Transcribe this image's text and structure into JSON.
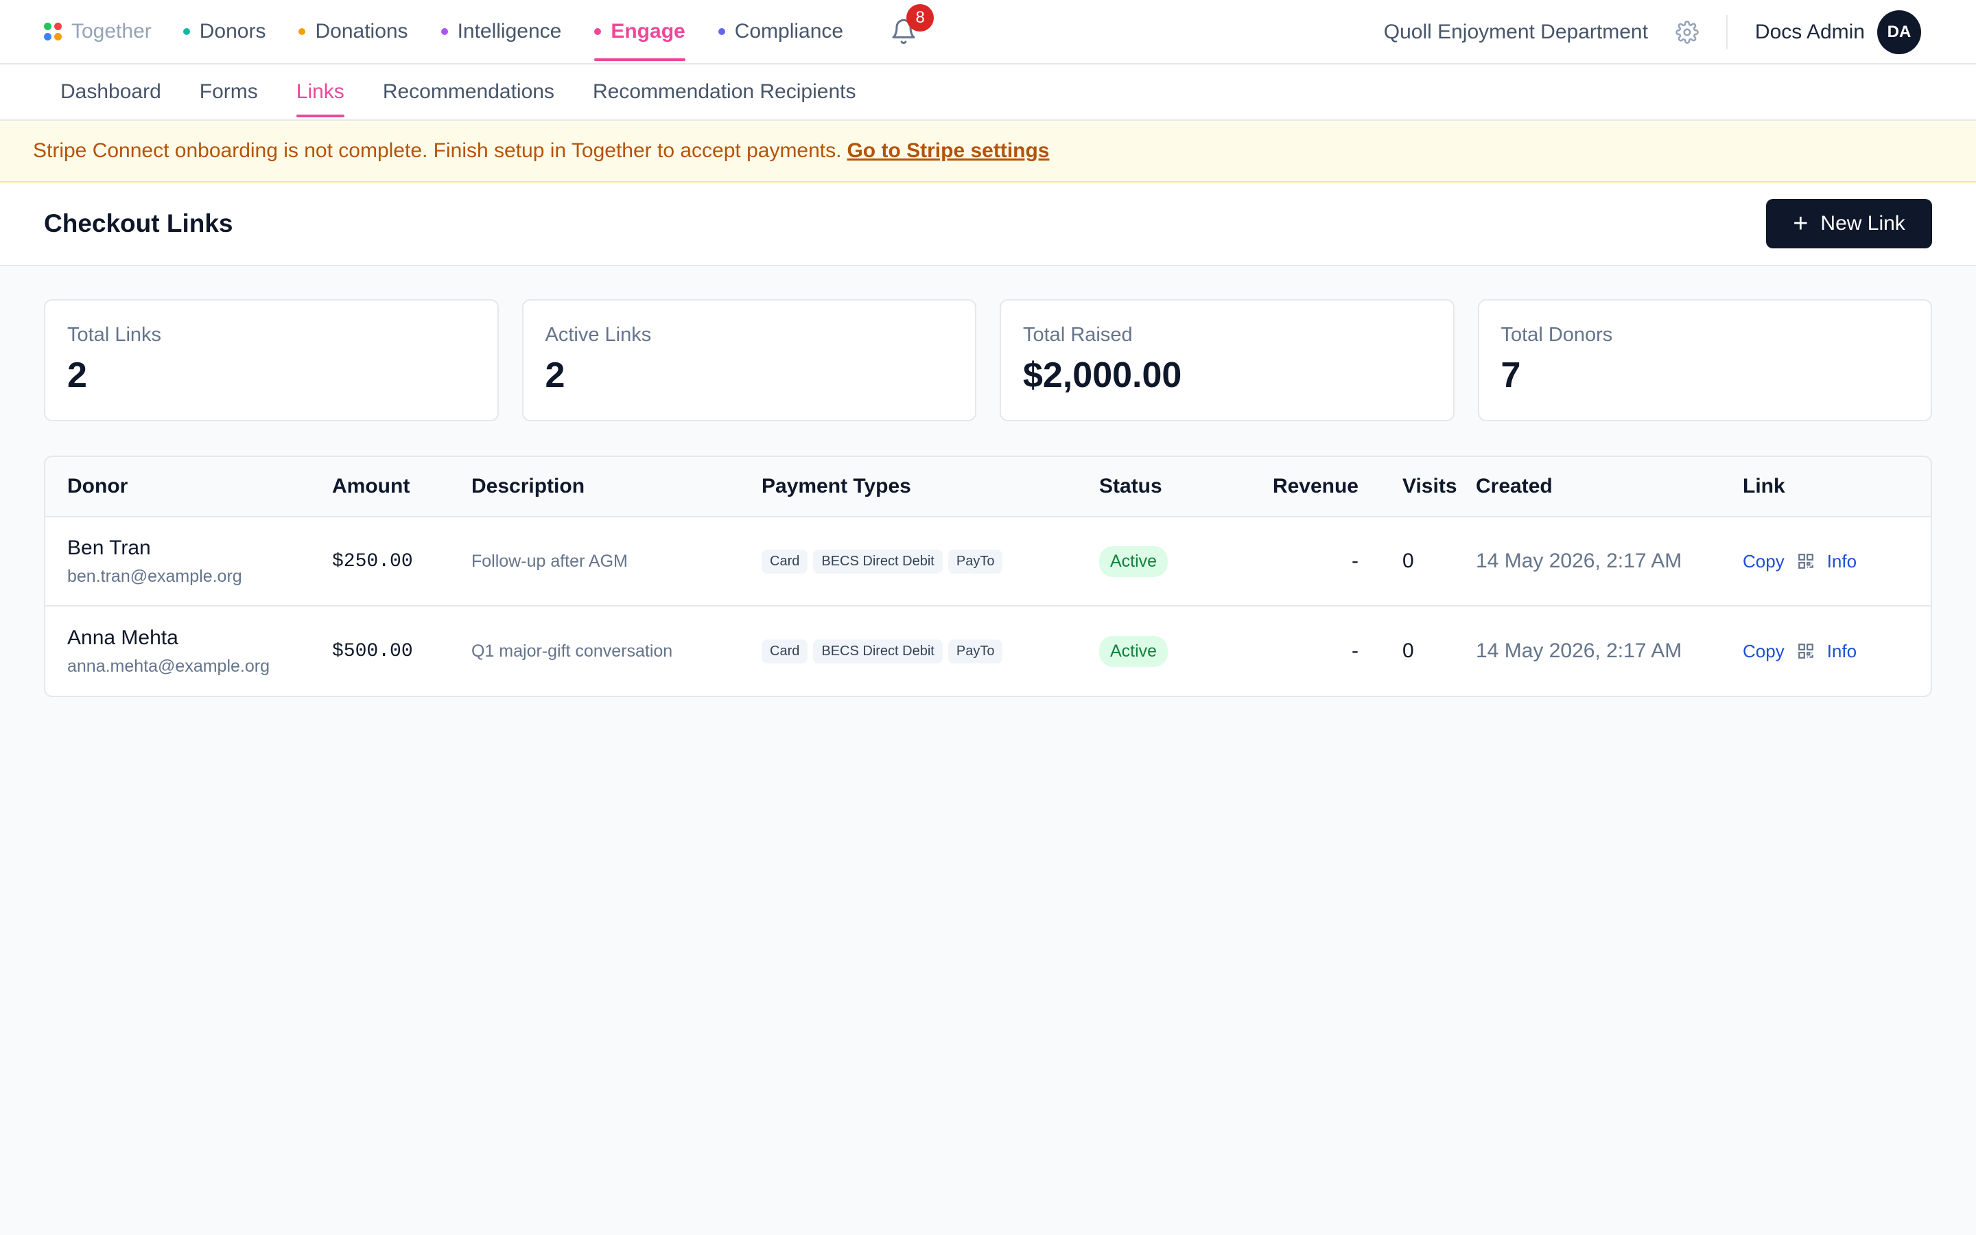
{
  "brand": {
    "name": "Together",
    "logo_colors": [
      "#22c55e",
      "#ef4444",
      "#3b82f6",
      "#f59e0b"
    ]
  },
  "nav": {
    "items": [
      {
        "label": "Donors",
        "color": "#14b8a6"
      },
      {
        "label": "Donations",
        "color": "#f59e0b"
      },
      {
        "label": "Intelligence",
        "color": "#a855f7"
      },
      {
        "label": "Engage",
        "color": "#ec4899"
      },
      {
        "label": "Compliance",
        "color": "#6366f1"
      }
    ],
    "notification_count": "8",
    "org_name": "Quoll Enjoyment Department",
    "user_name": "Docs Admin",
    "user_initials": "DA"
  },
  "subnav": {
    "items": [
      {
        "label": "Dashboard"
      },
      {
        "label": "Forms"
      },
      {
        "label": "Links"
      },
      {
        "label": "Recommendations"
      },
      {
        "label": "Recommendation Recipients"
      }
    ]
  },
  "banner": {
    "message": "Stripe Connect onboarding is not complete. Finish setup in Together to accept payments.",
    "link": "Go to Stripe settings"
  },
  "page": {
    "title": "Checkout Links",
    "new_link_label": "New Link"
  },
  "stats": [
    {
      "label": "Total Links",
      "value": "2"
    },
    {
      "label": "Active Links",
      "value": "2"
    },
    {
      "label": "Total Raised",
      "value": "$2,000.00"
    },
    {
      "label": "Total Donors",
      "value": "7"
    }
  ],
  "table": {
    "headers": {
      "donor": "Donor",
      "amount": "Amount",
      "description": "Description",
      "payment_types": "Payment Types",
      "status": "Status",
      "revenue": "Revenue",
      "visits": "Visits",
      "created": "Created",
      "link": "Link"
    },
    "rows": [
      {
        "name": "Ben Tran",
        "email": "ben.tran@example.org",
        "amount": "$250.00",
        "description": "Follow-up after AGM",
        "payment_types": [
          "Card",
          "BECS Direct Debit",
          "PayTo"
        ],
        "status": "Active",
        "revenue": "-",
        "visits": "0",
        "created": "14 May 2026, 2:17 AM",
        "copy_label": "Copy",
        "info_label": "Info"
      },
      {
        "name": "Anna Mehta",
        "email": "anna.mehta@example.org",
        "amount": "$500.00",
        "description": "Q1 major-gift conversation",
        "payment_types": [
          "Card",
          "BECS Direct Debit",
          "PayTo"
        ],
        "status": "Active",
        "revenue": "-",
        "visits": "0",
        "created": "14 May 2026, 2:17 AM",
        "copy_label": "Copy",
        "info_label": "Info"
      }
    ]
  }
}
